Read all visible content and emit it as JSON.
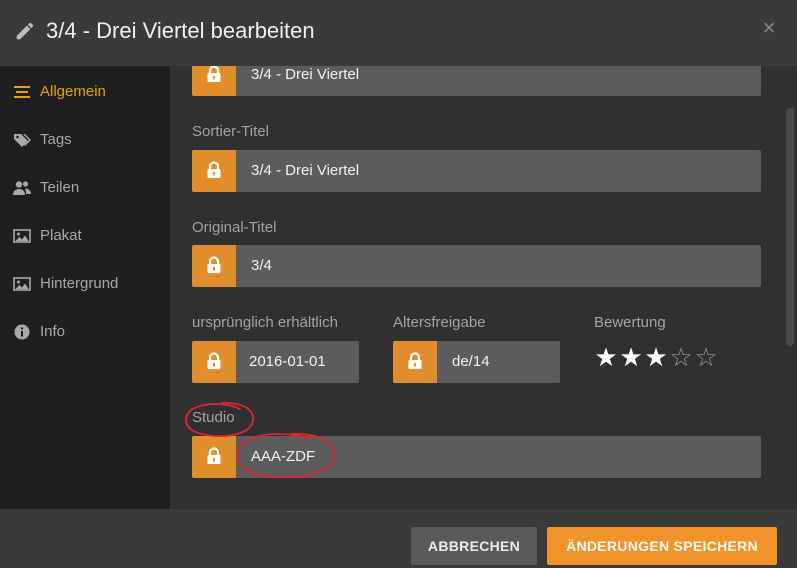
{
  "header": {
    "title": "3/4 - Drei Viertel bearbeiten",
    "edit_icon": "pencil-icon",
    "close_icon": "close-icon",
    "close_glyph": "×"
  },
  "sidebar": {
    "items": [
      {
        "label": "Allgemein",
        "icon": "list-icon",
        "active": true
      },
      {
        "label": "Tags",
        "icon": "tags-icon",
        "active": false
      },
      {
        "label": "Teilen",
        "icon": "users-icon",
        "active": false
      },
      {
        "label": "Plakat",
        "icon": "image-icon",
        "active": false
      },
      {
        "label": "Hintergrund",
        "icon": "image-icon",
        "active": false
      },
      {
        "label": "Info",
        "icon": "info-icon",
        "active": false
      }
    ]
  },
  "form": {
    "title_value": "3/4 - Drei Viertel",
    "sort_title_label": "Sortier-Titel",
    "sort_title_value": "3/4 - Drei Viertel",
    "original_title_label": "Original-Titel",
    "original_title_value": "3/4",
    "release_label": "ursprünglich erhältlich",
    "release_value": "2016-01-01",
    "rating_age_label": "Altersfreigabe",
    "rating_age_value": "de/14",
    "rating_label": "Bewertung",
    "rating_stars": 3,
    "rating_max": 5,
    "studio_label": "Studio",
    "studio_value": "AAA-ZDF"
  },
  "footer": {
    "cancel_label": "ABBRECHEN",
    "save_label": "ÄNDERUNGEN SPEICHERN"
  },
  "colors": {
    "accent": "#e5a00d",
    "lock": "#e08d2c",
    "annotation": "#e0262b"
  }
}
